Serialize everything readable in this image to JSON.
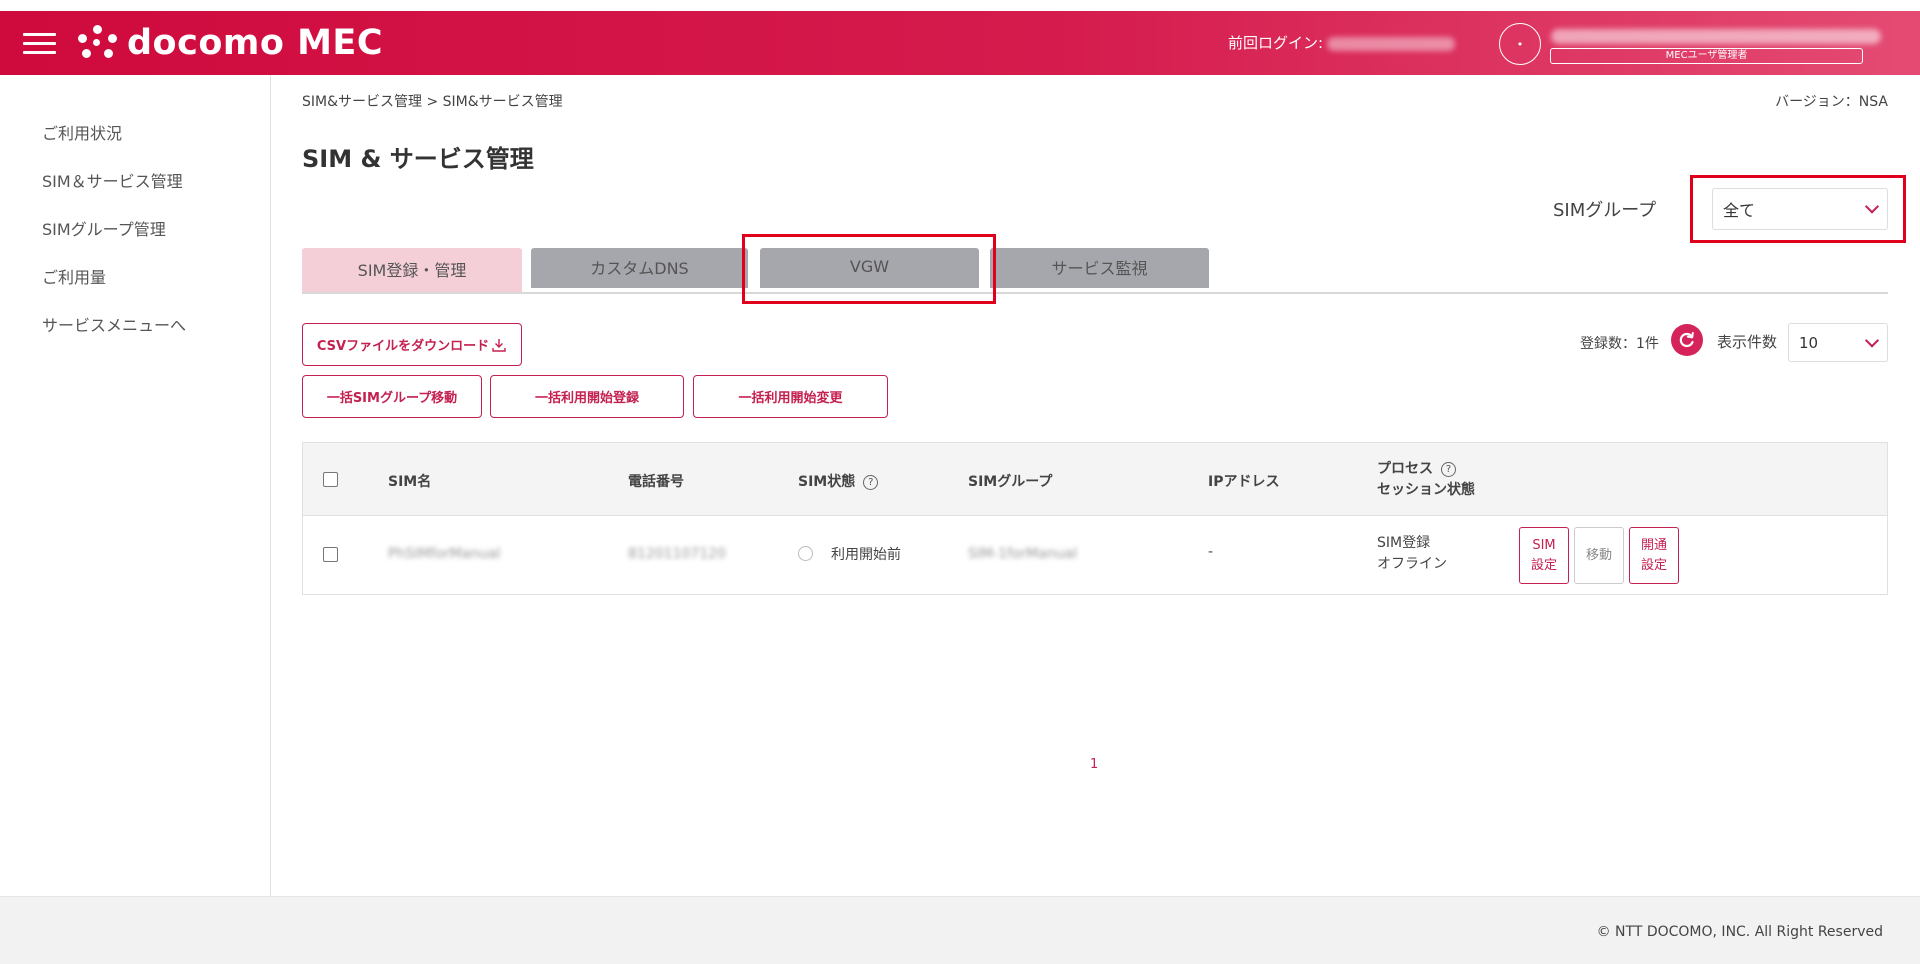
{
  "header": {
    "brand": "docomo MEC",
    "last_login_label": "前回ログイン:",
    "last_login_value": "2024/03/13 13:21",
    "avatar_initial": "•",
    "account_name": "(account name redacted)",
    "role": "MECユーザ管理者"
  },
  "sidebar": {
    "items": [
      {
        "label": "ご利用状況"
      },
      {
        "label": "SIM＆サービス管理"
      },
      {
        "label": "SIMグループ管理"
      },
      {
        "label": "ご利用量"
      },
      {
        "label": "サービスメニューへ"
      }
    ]
  },
  "breadcrumb": "SIM&サービス管理 > SIM&サービス管理",
  "version": "バージョン：NSA",
  "page_title": "SIM & サービス管理",
  "sim_group": {
    "label": "SIMグループ",
    "selected": "全て"
  },
  "tabs": [
    {
      "label": "SIM登録・管理",
      "active": true
    },
    {
      "label": "カスタムDNS",
      "active": false
    },
    {
      "label": "VGW",
      "active": false
    },
    {
      "label": "サービス監視",
      "active": false
    }
  ],
  "actions": {
    "csv_download": "CSVファイルをダウンロード",
    "bulk_group_move": "一括SIMグループ移動",
    "bulk_start_register": "一括利用開始登録",
    "bulk_start_change": "一括利用開始変更"
  },
  "list_meta": {
    "count_label": "登録数：1件",
    "per_page_label": "表示件数",
    "per_page_value": "10"
  },
  "table": {
    "headers": {
      "sim_name": "SIM名",
      "phone": "電話番号",
      "sim_status": "SIM状態",
      "sim_group": "SIMグループ",
      "ip": "IPアドレス",
      "process_line1": "プロセス",
      "process_line2": "セッション状態"
    },
    "rows": [
      {
        "sim_name": "PhSIMforManual",
        "phone": "81201107120",
        "sim_status": "利用開始前",
        "sim_group": "SIM-1forManual",
        "ip": "-",
        "process": "SIM登録",
        "session": "オフライン",
        "btn_sim_settings": "SIM\n設定",
        "btn_move": "移動",
        "btn_related_settings": "開通\n設定"
      }
    ]
  },
  "pagination": {
    "current": "1"
  },
  "footer": {
    "copyright": "© NTT DOCOMO, INC. All Right Reserved"
  },
  "colors": {
    "brand": "#cf0a3d",
    "accent": "#c42050",
    "tab_active": "#f4cfd8",
    "tab_inactive": "#a6a6ad",
    "highlight_box": "#e0001b"
  }
}
